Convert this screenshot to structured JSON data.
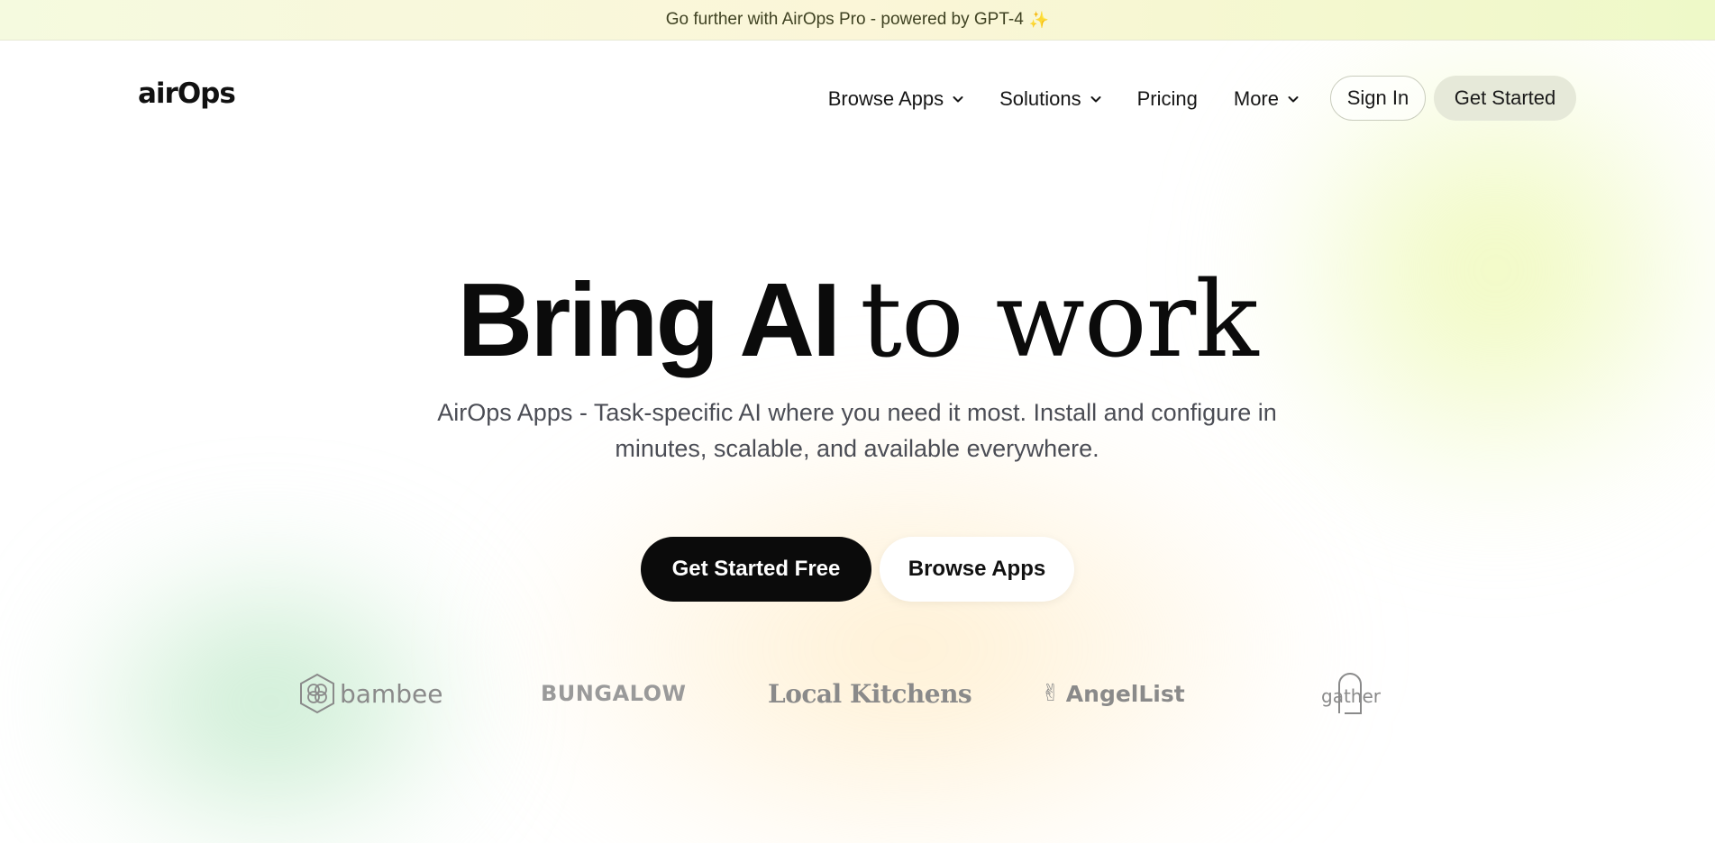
{
  "announcement": {
    "text": "Go further with AirOps Pro - powered by GPT-4",
    "icon": "sparkle-icon"
  },
  "header": {
    "logo": "airOps",
    "nav": [
      {
        "label": "Browse Apps",
        "has_dropdown": true
      },
      {
        "label": "Solutions",
        "has_dropdown": true
      },
      {
        "label": "Pricing",
        "has_dropdown": false
      },
      {
        "label": "More",
        "has_dropdown": true
      }
    ],
    "sign_in": "Sign In",
    "get_started": "Get Started"
  },
  "hero": {
    "title_bold": "Bring AI",
    "title_light": "to work",
    "subtitle": "AirOps Apps - Task-specific AI where you need it most. Install and configure in minutes, scalable, and available everywhere.",
    "cta_primary": "Get Started Free",
    "cta_secondary": "Browse Apps"
  },
  "customer_logos": [
    "bambee",
    "BUNGALOW",
    "Local Kitchens",
    "AngelList",
    "gather"
  ],
  "colors": {
    "primary_button": "#0b0b0b",
    "announcement_bg": "#f5fadf",
    "accent_soft": "#e6e9d9"
  }
}
